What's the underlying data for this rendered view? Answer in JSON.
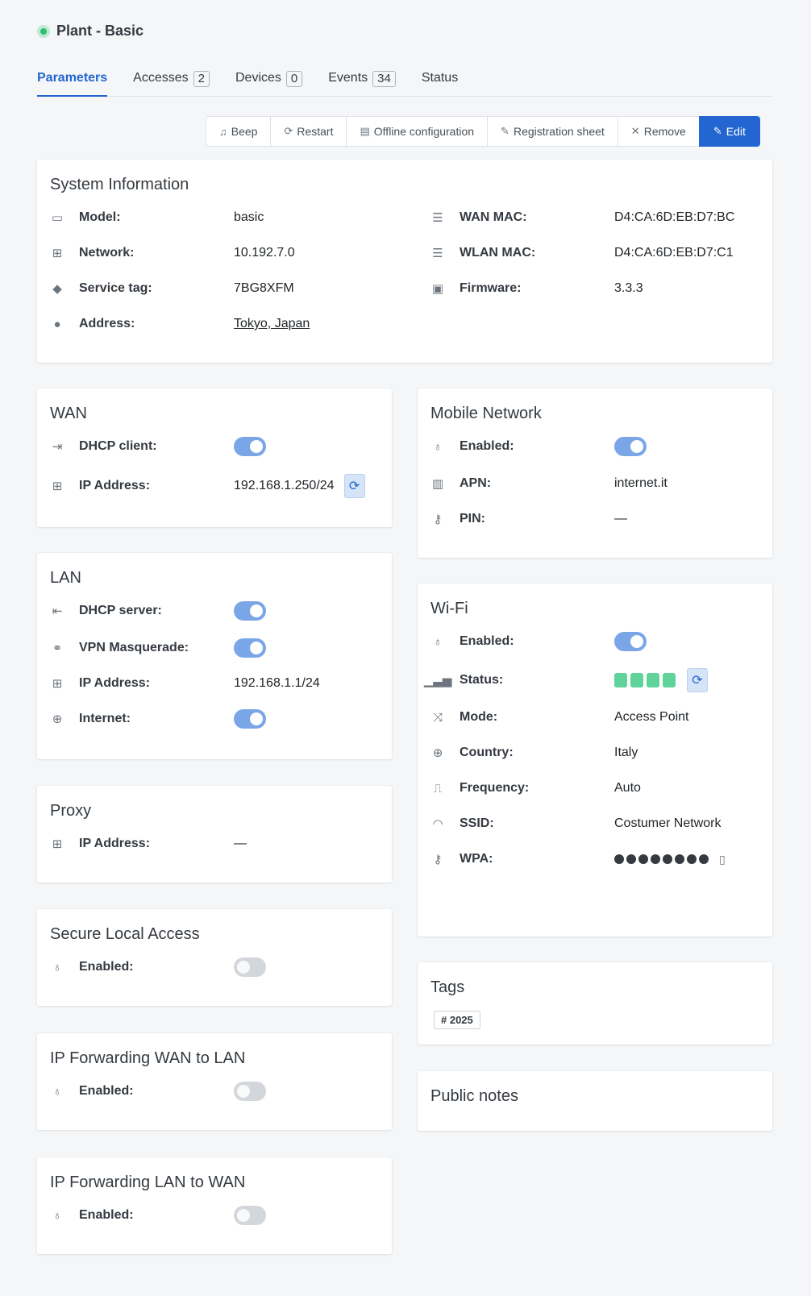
{
  "header": {
    "title": "Plant - Basic"
  },
  "tabs": [
    {
      "label": "Parameters",
      "count": null
    },
    {
      "label": "Accesses",
      "count": "2"
    },
    {
      "label": "Devices",
      "count": "0"
    },
    {
      "label": "Events",
      "count": "34"
    },
    {
      "label": "Status",
      "count": null
    }
  ],
  "toolbar": {
    "beep": "Beep",
    "restart": "Restart",
    "offline": "Offline configuration",
    "registration": "Registration sheet",
    "remove": "Remove",
    "edit": "Edit"
  },
  "system": {
    "title": "System Information",
    "model_label": "Model:",
    "model": "basic",
    "network_label": "Network:",
    "network": "10.192.7.0",
    "service_label": "Service tag:",
    "service": "7BG8XFM",
    "address_label": "Address:",
    "address": "Tokyo, Japan",
    "wanmac_label": "WAN MAC:",
    "wanmac": "D4:CA:6D:EB:D7:BC",
    "wlanmac_label": "WLAN MAC:",
    "wlanmac": "D4:CA:6D:EB:D7:C1",
    "firmware_label": "Firmware:",
    "firmware": "3.3.3"
  },
  "wan": {
    "title": "WAN",
    "dhcp_label": "DHCP client:",
    "dhcp": true,
    "ip_label": "IP Address:",
    "ip": "192.168.1.250/24"
  },
  "lan": {
    "title": "LAN",
    "dhcp_label": "DHCP server:",
    "dhcp": true,
    "vpn_label": "VPN Masquerade:",
    "vpn": true,
    "ip_label": "IP Address:",
    "ip": "192.168.1.1/24",
    "internet_label": "Internet:",
    "internet": true
  },
  "proxy": {
    "title": "Proxy",
    "ip_label": "IP Address:",
    "ip": "—"
  },
  "secure": {
    "title": "Secure Local Access",
    "enabled_label": "Enabled:",
    "enabled": false
  },
  "fwd_wan_lan": {
    "title": "IP Forwarding WAN to LAN",
    "enabled_label": "Enabled:",
    "enabled": false
  },
  "fwd_lan_wan": {
    "title": "IP Forwarding LAN to WAN",
    "enabled_label": "Enabled:",
    "enabled": false
  },
  "mobile": {
    "title": "Mobile Network",
    "enabled_label": "Enabled:",
    "enabled": true,
    "apn_label": "APN:",
    "apn": "internet.it",
    "pin_label": "PIN:",
    "pin": "—"
  },
  "wifi": {
    "title": "Wi-Fi",
    "enabled_label": "Enabled:",
    "enabled": true,
    "status_label": "Status:",
    "signal_bars": 4,
    "signal_color": "#5fd39a",
    "mode_label": "Mode:",
    "mode": "Access Point",
    "country_label": "Country:",
    "country": "Italy",
    "frequency_label": "Frequency:",
    "frequency": "Auto",
    "ssid_label": "SSID:",
    "ssid": "Costumer Network",
    "wpa_label": "WPA:",
    "wpa_masked_length": 8
  },
  "tags": {
    "title": "Tags",
    "items": [
      "# 2025"
    ]
  },
  "notes": {
    "title": "Public notes"
  },
  "colors": {
    "accent": "#2366d1",
    "toggle_on": "#7aa6e8",
    "toggle_off": "#d3d6da",
    "status_online": "#2fbf71"
  }
}
